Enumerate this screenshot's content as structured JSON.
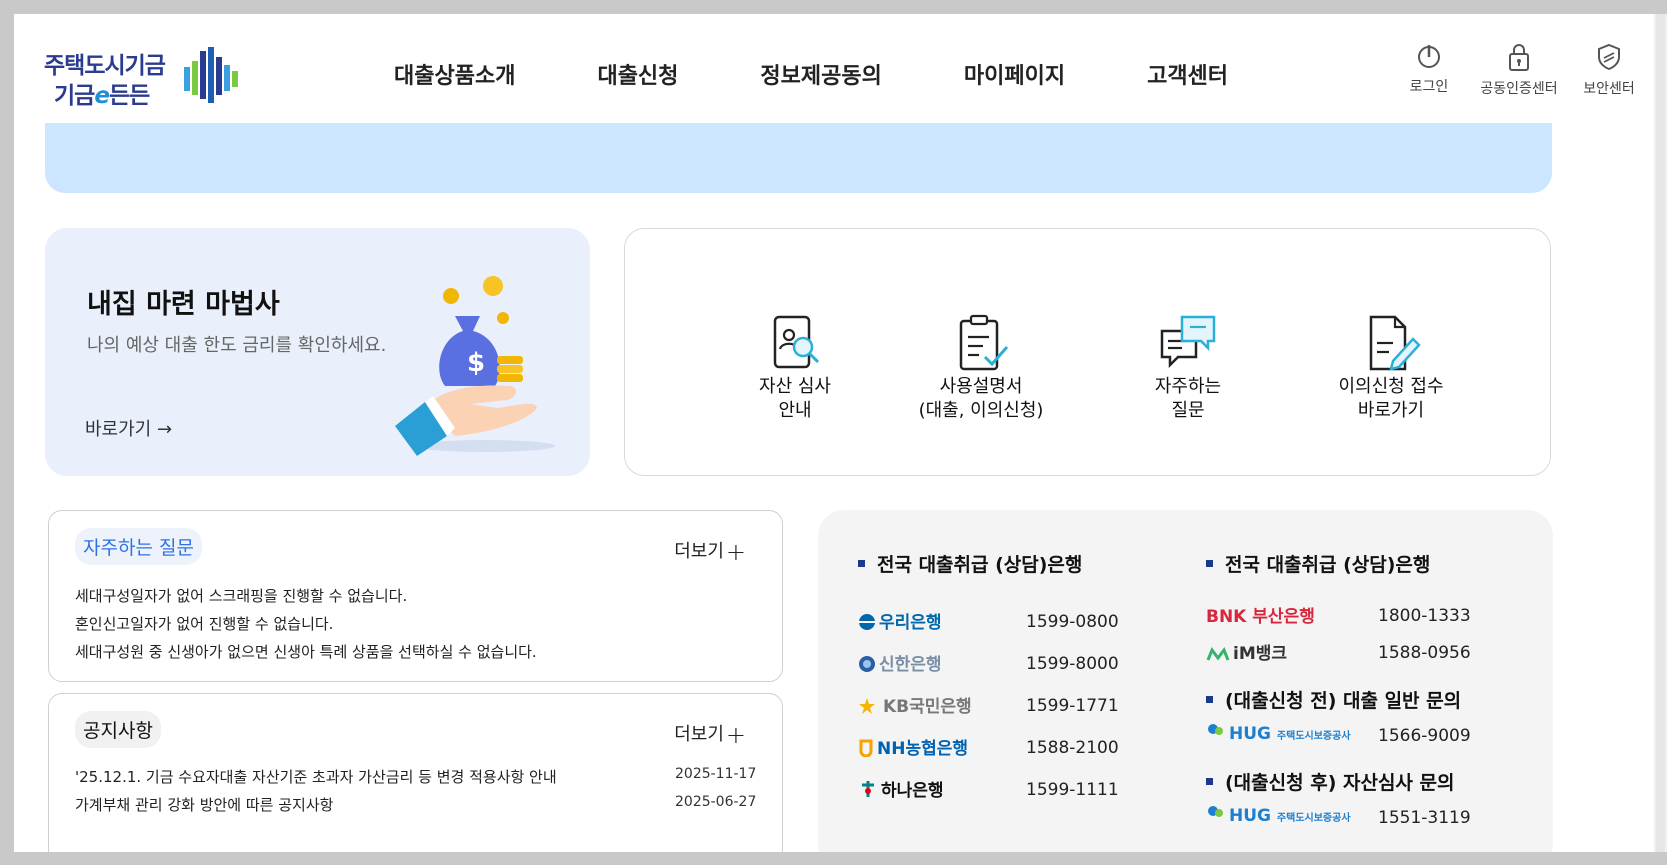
{
  "header": {
    "logo_line1": "주택도시기금",
    "logo_line2_prefix": "기금",
    "logo_line2_e": "e",
    "logo_line2_suffix": "든든",
    "nav": [
      "대출상품소개",
      "대출신청",
      "정보제공동의",
      "마이페이지",
      "고객센터"
    ],
    "util": [
      {
        "label": "로그인",
        "icon": "power-icon"
      },
      {
        "label": "공동인증센터",
        "icon": "lock-icon"
      },
      {
        "label": "보안센터",
        "icon": "shield-icon"
      }
    ]
  },
  "wizard": {
    "title": "내집 마련 마법사",
    "subtitle": "나의 예상 대출 한도 금리를 확인하세요.",
    "link": "바로가기 →"
  },
  "quick_menu": [
    {
      "line1": "자산 심사",
      "line2": "안내",
      "icon": "document-search-icon"
    },
    {
      "line1": "사용설명서",
      "line2": "(대출, 이의신청)",
      "icon": "clipboard-check-icon"
    },
    {
      "line1": "자주하는",
      "line2": "질문",
      "icon": "chat-bubbles-icon"
    },
    {
      "line1": "이의신청 접수",
      "line2": "바로가기",
      "icon": "document-pen-icon"
    }
  ],
  "faq": {
    "title": "자주하는 질문",
    "more": "더보기",
    "items": [
      "세대구성일자가 없어 스크래핑을 진행할 수 없습니다.",
      "혼인신고일자가 없어 진행할 수 없습니다.",
      "세대구성원 중 신생아가 없으면 신생아 특례 상품을 선택하실 수 없습니다."
    ]
  },
  "notice": {
    "title": "공지사항",
    "more": "더보기",
    "items": [
      {
        "title": "'25.12.1. 기금 수요자대출 자산기준 초과자 가산금리 등 변경 적용사항 안내",
        "date": "2025-11-17"
      },
      {
        "title": "가계부채 관리 강화 방안에 따른 공지사항",
        "date": "2025-06-27"
      }
    ]
  },
  "banks": {
    "left_heading": "전국 대출취급 (상담)은행",
    "left": [
      {
        "name": "우리은행",
        "phone": "1599-0800",
        "color": "#0067ac"
      },
      {
        "name": "신한은행",
        "phone": "1599-8000",
        "color": "#7a8fa6"
      },
      {
        "name": "KB국민은행",
        "phone": "1599-1771",
        "color": "#777777"
      },
      {
        "name": "NH농협은행",
        "phone": "1588-2100",
        "color": "#0062b1"
      },
      {
        "name": "하나은행",
        "phone": "1599-1111",
        "color": "#111111"
      }
    ],
    "right_heading": "전국 대출취급 (상담)은행",
    "right": [
      {
        "name": "BNK 부산은행",
        "phone": "1800-1333",
        "color": "#d7263d"
      },
      {
        "name": "iM뱅크",
        "phone": "1588-0956",
        "color": "#333333"
      }
    ],
    "before_heading": "(대출신청 전) 대출 일반 문의",
    "before": {
      "name": "HUG",
      "sub": "주택도시보증공사",
      "phone": "1566-9009",
      "color": "#1e7fd0"
    },
    "after_heading": "(대출신청 후) 자산심사 문의",
    "after": {
      "name": "HUG",
      "sub": "주택도시보증공사",
      "phone": "1551-3119",
      "color": "#1e7fd0"
    }
  },
  "colors": {
    "banner": "#cce6ff",
    "wizard_bg": "#e9f0fb",
    "accent": "#2e72e6",
    "navy": "#2b3b8f"
  }
}
